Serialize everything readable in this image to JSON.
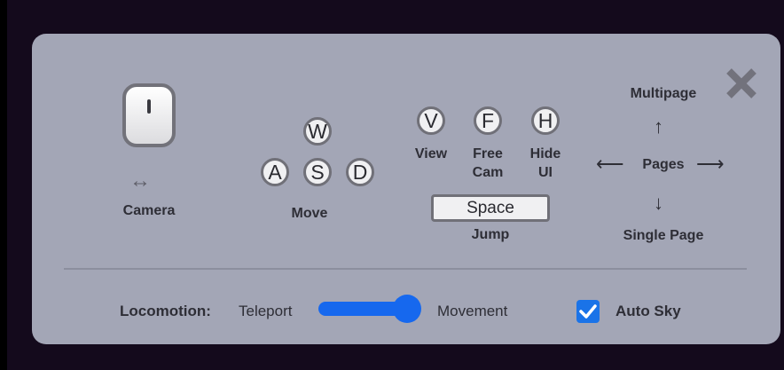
{
  "controls": {
    "camera": {
      "label": "Camera",
      "arrow": "↔"
    },
    "move": {
      "label": "Move",
      "keys": {
        "w": "W",
        "a": "A",
        "s": "S",
        "d": "D"
      }
    },
    "view": {
      "key": "V",
      "label": "View"
    },
    "free_cam": {
      "key": "F",
      "label_line1": "Free",
      "label_line2": "Cam"
    },
    "hide_ui": {
      "key": "H",
      "label_line1": "Hide",
      "label_line2": "UI"
    },
    "jump": {
      "key": "Space",
      "label": "Jump"
    },
    "pages": {
      "label": "Pages",
      "up_label": "Multipage",
      "down_label": "Single Page",
      "arrow_up": "↑",
      "arrow_down": "↓",
      "arrow_left": "⟵",
      "arrow_right": "⟶"
    }
  },
  "footer": {
    "locomotion_label": "Locomotion:",
    "toggle_left": "Teleport",
    "toggle_right": "Movement",
    "toggle_value": 1,
    "auto_sky_label": "Auto Sky",
    "auto_sky_checked": true
  },
  "colors": {
    "panel": "#a3a6b6",
    "accent": "#1668ee",
    "background": "#140a1c"
  },
  "icons": [
    "close-icon",
    "mouse-icon",
    "checkmark-icon"
  ]
}
